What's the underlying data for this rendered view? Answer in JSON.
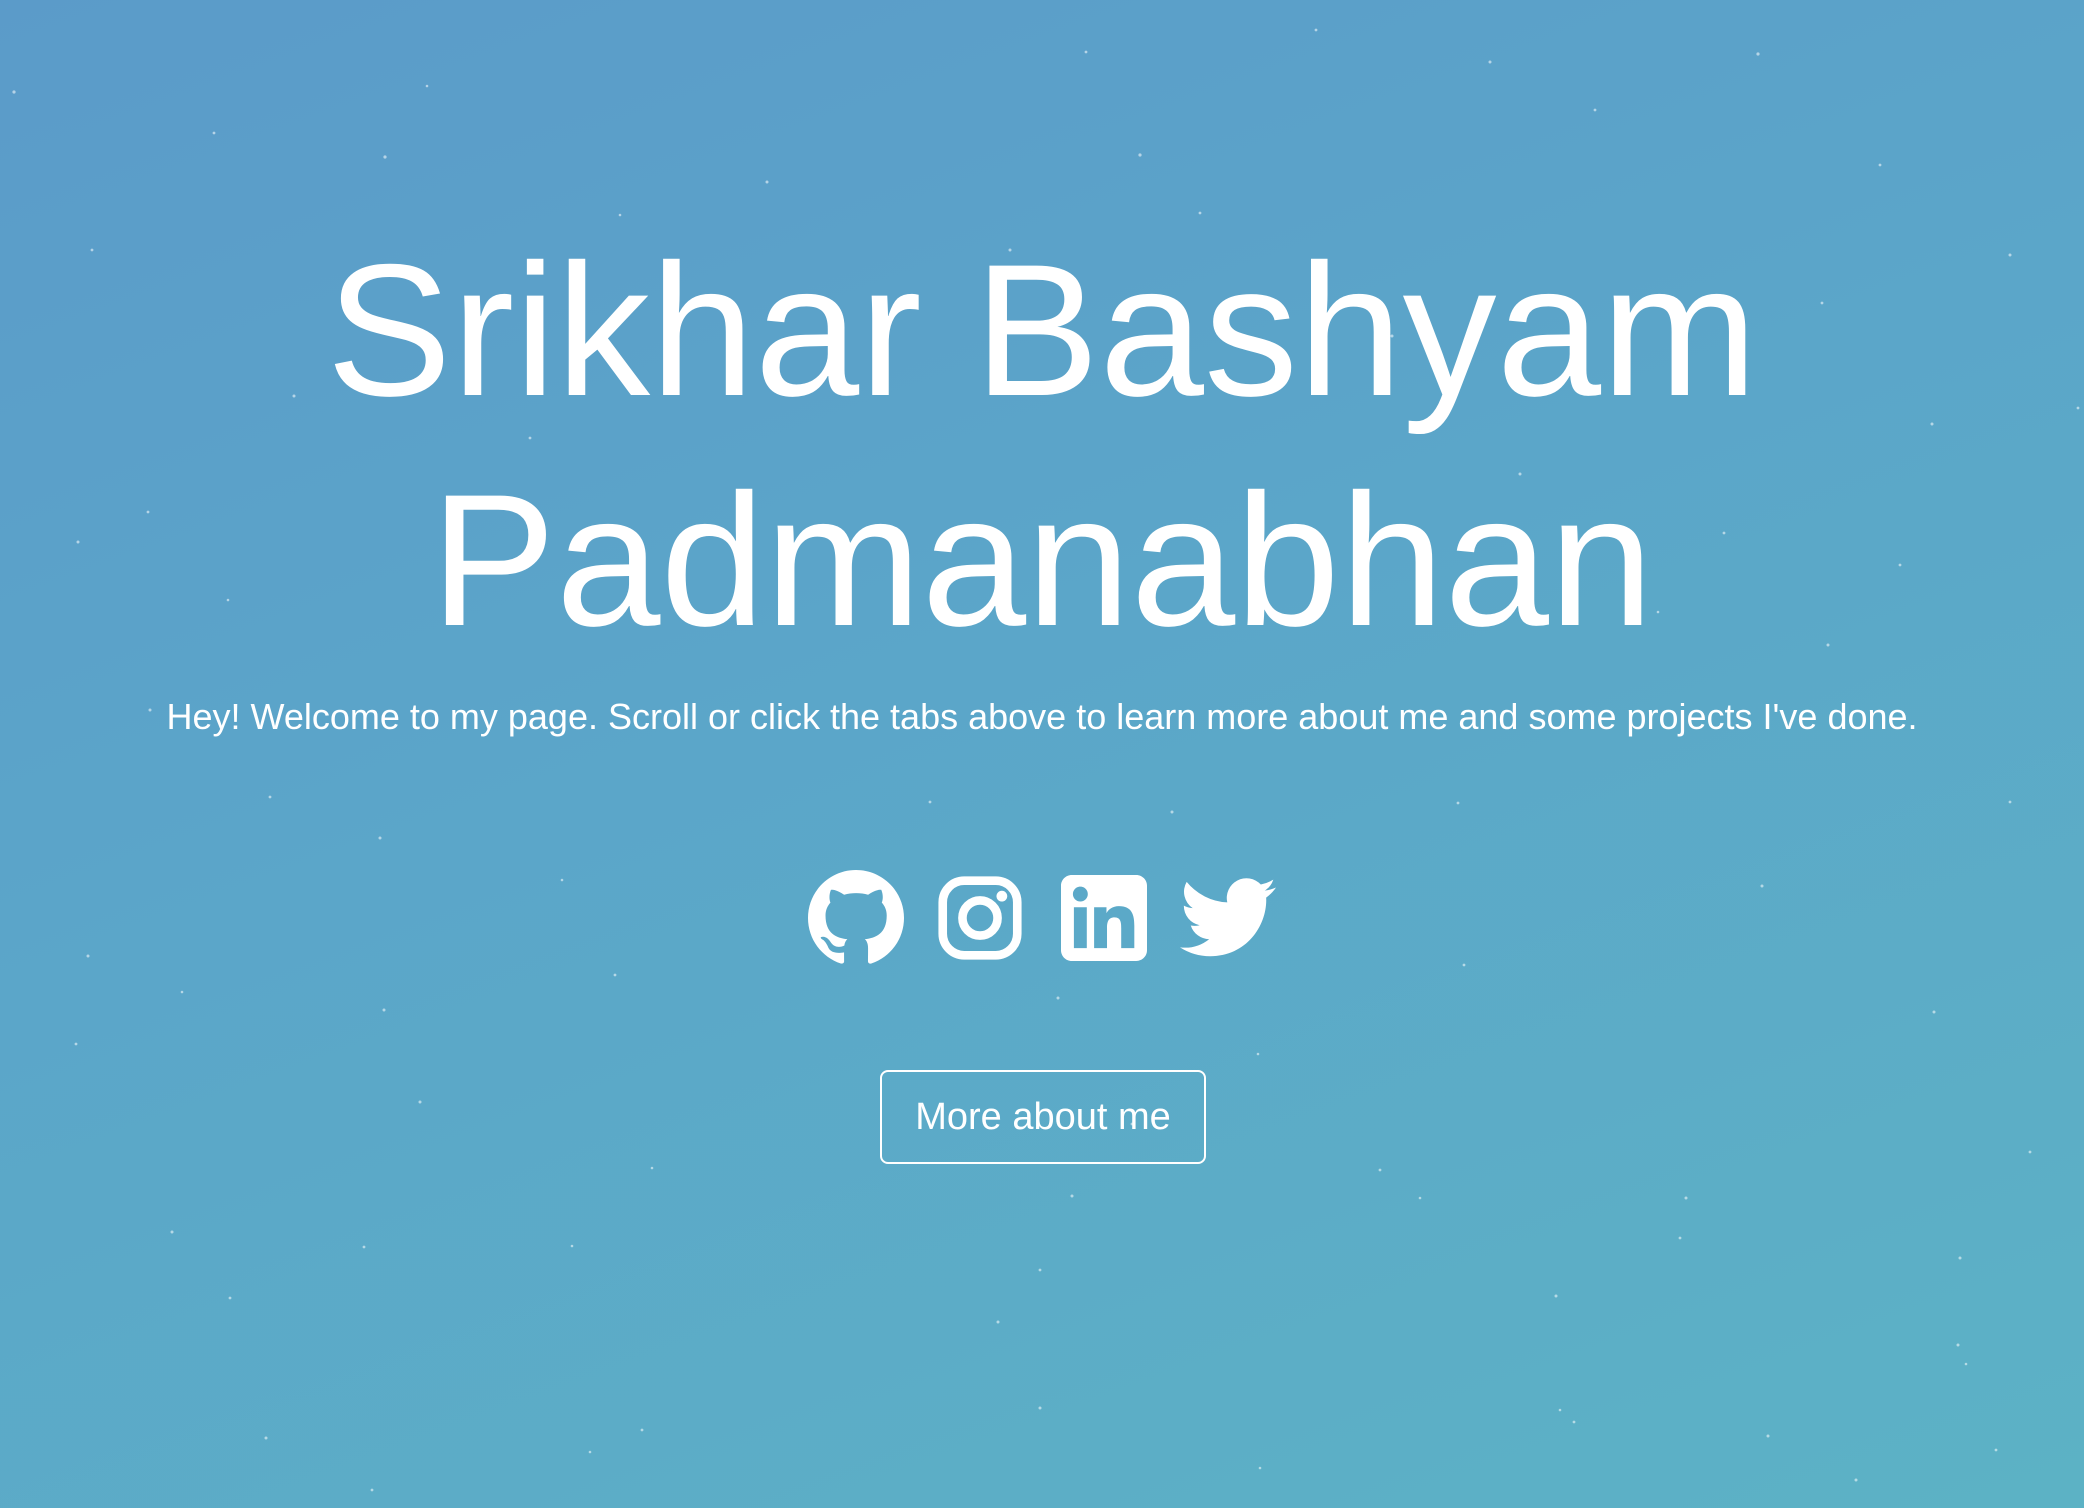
{
  "hero": {
    "title_line1": "Srikhar Bashyam",
    "title_line2": "Padmanabhan",
    "tagline": "Hey! Welcome to my page. Scroll or click the tabs above to learn more about me and some projects I've done.",
    "cta_label": "More about me"
  },
  "social_links": [
    {
      "name": "GitHub",
      "icon": "github-icon"
    },
    {
      "name": "Instagram",
      "icon": "instagram-icon"
    },
    {
      "name": "LinkedIn",
      "icon": "linkedin-icon"
    },
    {
      "name": "Twitter",
      "icon": "twitter-icon"
    }
  ],
  "colors": {
    "background_start": "#5b9bc9",
    "background_end": "#5cb2c5",
    "foreground": "#ffffff"
  }
}
